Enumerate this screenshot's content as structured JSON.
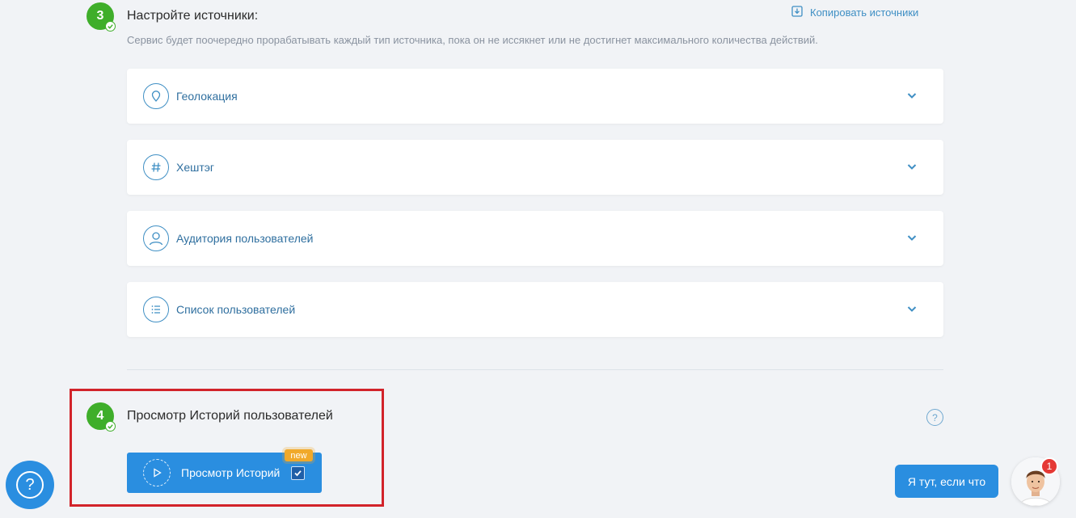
{
  "step3": {
    "number": "3",
    "title": "Настройте источники:",
    "description": "Сервис будет поочередно прорабатывать каждый тип источника, пока он не иссякнет или не достигнет максимального количества действий.",
    "copy_link": "Копировать источники",
    "sources": [
      {
        "label": "Геолокация",
        "icon": "location-pin-icon"
      },
      {
        "label": "Хештэг",
        "icon": "hashtag-icon"
      },
      {
        "label": "Аудитория пользователей",
        "icon": "user-audience-icon"
      },
      {
        "label": "Список пользователей",
        "icon": "list-icon"
      }
    ]
  },
  "step4": {
    "number": "4",
    "title": "Просмотр Историй пользователей",
    "help": "?",
    "button_label": "Просмотр Историй",
    "new_badge": "new",
    "checked": true
  },
  "floating": {
    "help": "?",
    "chat_label": "Я тут, если что",
    "notification_count": "1"
  },
  "colors": {
    "accent": "#2a8ee0",
    "step_green": "#3fae2a",
    "link": "#3f8fc4",
    "highlight": "#d2232a",
    "badge_new": "#f1a92a"
  }
}
